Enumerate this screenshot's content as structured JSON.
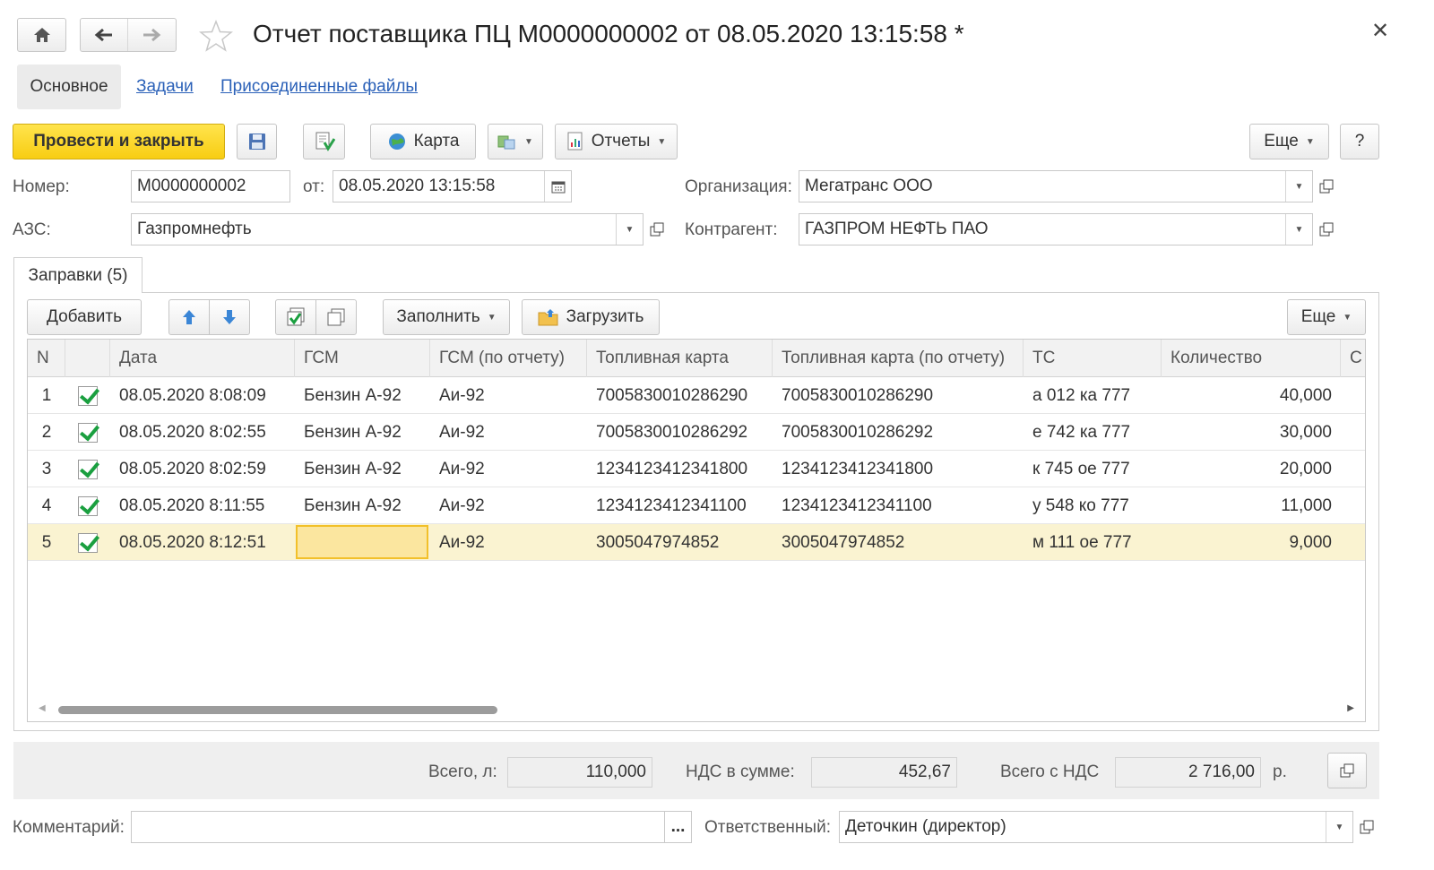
{
  "header": {
    "title": "Отчет поставщика ПЦ М0000000002 от 08.05.2020 13:15:58 *"
  },
  "tabs": {
    "main": "Основное",
    "tasks": "Задачи",
    "files": "Присоединенные файлы"
  },
  "toolbar": {
    "post_close": "Провести и закрыть",
    "map": "Карта",
    "reports": "Отчеты",
    "more": "Еще",
    "help": "?"
  },
  "form": {
    "number_label": "Номер:",
    "number_value": "М0000000002",
    "from_label": "от:",
    "date_value": "08.05.2020 13:15:58",
    "org_label": "Организация:",
    "org_value": "Мегатранс ООО",
    "azs_label": "АЗС:",
    "azs_value": "Газпромнефть",
    "contractor_label": "Контрагент:",
    "contractor_value": "ГАЗПРОМ НЕФТЬ ПАО"
  },
  "table_tab": {
    "label": "Заправки (5)"
  },
  "table_toolbar": {
    "add": "Добавить",
    "fill": "Заполнить",
    "load": "Загрузить",
    "more": "Еще"
  },
  "table": {
    "columns": [
      "N",
      "",
      "Дата",
      "ГСМ",
      "ГСМ (по отчету)",
      "Топливная карта",
      "Топливная карта (по отчету)",
      "ТС",
      "Количество",
      "С"
    ],
    "rows": [
      {
        "n": "1",
        "checked": true,
        "date": "08.05.2020 8:08:09",
        "gsm": "Бензин А-92",
        "gsm_report": "Аи-92",
        "card": "7005830010286290",
        "card_report": "7005830010286290",
        "ts": "а 012 ка 777",
        "qty": "40,000"
      },
      {
        "n": "2",
        "checked": true,
        "date": "08.05.2020 8:02:55",
        "gsm": "Бензин А-92",
        "gsm_report": "Аи-92",
        "card": "7005830010286292",
        "card_report": "7005830010286292",
        "ts": "е 742 ка 777",
        "qty": "30,000"
      },
      {
        "n": "3",
        "checked": true,
        "date": "08.05.2020 8:02:59",
        "gsm": "Бензин А-92",
        "gsm_report": "Аи-92",
        "card": "1234123412341800",
        "card_report": "1234123412341800",
        "ts": "к 745 ое 777",
        "qty": "20,000"
      },
      {
        "n": "4",
        "checked": true,
        "date": "08.05.2020 8:11:55",
        "gsm": "Бензин А-92",
        "gsm_report": "Аи-92",
        "card": "1234123412341100",
        "card_report": "1234123412341100",
        "ts": "у 548 ко 777",
        "qty": "11,000"
      },
      {
        "n": "5",
        "checked": true,
        "date": "08.05.2020 8:12:51",
        "gsm": "",
        "gsm_report": "Аи-92",
        "card": "3005047974852",
        "card_report": "3005047974852",
        "ts": "м 111 ое 777",
        "qty": "9,000"
      }
    ]
  },
  "totals": {
    "liters_label": "Всего, л:",
    "liters_value": "110,000",
    "vat_label": "НДС в сумме:",
    "vat_value": "452,67",
    "total_label": "Всего с НДС",
    "total_value": "2 716,00",
    "currency": "р."
  },
  "footer": {
    "comment_label": "Комментарий:",
    "comment_value": "",
    "comment_button": "...",
    "responsible_label": "Ответственный:",
    "responsible_value": "Деточкин (директор)"
  },
  "colors": {
    "primary_button": "#f8cd12",
    "link": "#2b61b8",
    "selected_row": "#faf3d1",
    "active_cell": "#fbe69f",
    "check": "#1a9f3f"
  }
}
